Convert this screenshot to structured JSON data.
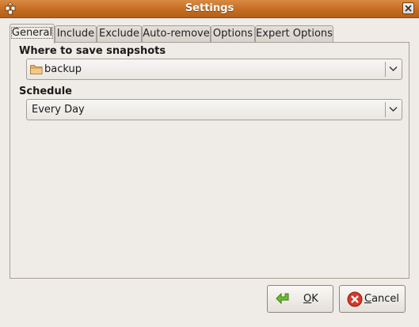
{
  "window": {
    "title": "Settings"
  },
  "tabs": [
    {
      "label": "General",
      "active": true
    },
    {
      "label": "Include",
      "active": false
    },
    {
      "label": "Exclude",
      "active": false
    },
    {
      "label": "Auto-remove",
      "active": false
    },
    {
      "label": "Options",
      "active": false
    },
    {
      "label": "Expert Options",
      "active": false
    }
  ],
  "general": {
    "save_location_label": "Where to save snapshots",
    "save_location_value": "backup",
    "schedule_label": "Schedule",
    "schedule_value": "Every Day"
  },
  "buttons": {
    "ok": {
      "mnemonic": "O",
      "rest": "K"
    },
    "cancel": {
      "mnemonic": "C",
      "rest": "ancel"
    }
  }
}
